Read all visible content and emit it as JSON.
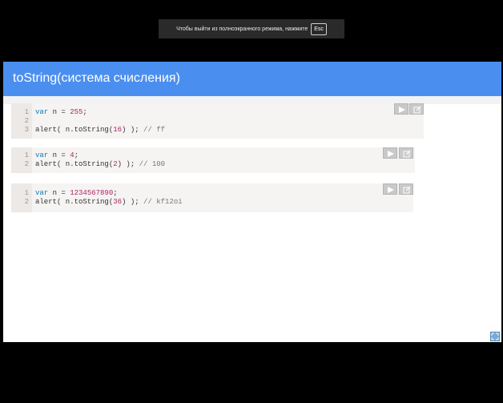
{
  "toast": {
    "message": "Чтобы выйти из полноэкранного режима, нажмите",
    "key": "Esc"
  },
  "slide": {
    "title": "toString(система счисления)"
  },
  "blocks": [
    {
      "lines": [
        {
          "num": "1",
          "code": "var n = 255;"
        },
        {
          "num": "2",
          "code": ""
        },
        {
          "num": "3",
          "code": "alert( n.toString(16) ); // ff"
        }
      ]
    },
    {
      "lines": [
        {
          "num": "1",
          "code": "var n = 4;"
        },
        {
          "num": "2",
          "code": "alert( n.toString(2) ); // 100"
        }
      ]
    },
    {
      "lines": [
        {
          "num": "1",
          "code": "var n = 1234567890;"
        },
        {
          "num": "2",
          "code": "alert( n.toString(36) ); // kf12oi"
        }
      ]
    }
  ],
  "icons": {
    "run": "play-icon",
    "edit": "edit-icon",
    "fullscreen": "fullscreen-icon"
  }
}
